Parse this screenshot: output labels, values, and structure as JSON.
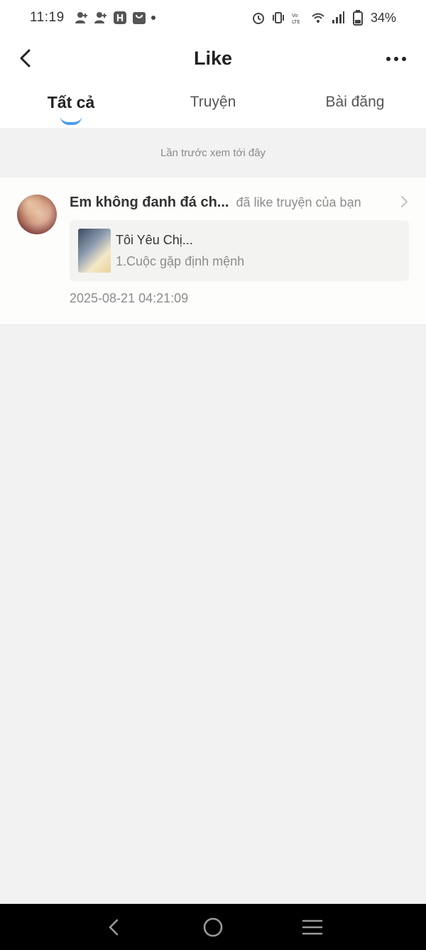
{
  "status_bar": {
    "time": "11:19",
    "battery": "34%",
    "left_icons": [
      "person-add-icon",
      "person-add-icon",
      "h-app-icon",
      "shopping-bag-icon",
      "notification-dot"
    ],
    "right_icons": [
      "alarm-icon",
      "vibrate-icon",
      "volte-icon",
      "wifi-icon",
      "signal-icon",
      "battery-icon"
    ]
  },
  "header": {
    "title": "Like",
    "back_icon": "chevron-left-icon",
    "more_icon": "more-horizontal-icon"
  },
  "tabs": [
    {
      "label": "Tất cả",
      "active": true
    },
    {
      "label": "Truyện",
      "active": false
    },
    {
      "label": "Bài đăng",
      "active": false
    }
  ],
  "last_seen_note": "Lần trước xem tới đây",
  "notifications": [
    {
      "user_name": "Em không đanh đá ch...",
      "action": "đã like truyện của bạn",
      "story_title": "Tôi Yêu Chị...",
      "chapter": "1.Cuộc gặp định mệnh",
      "timestamp": "2025-08-21 04:21:09"
    }
  ],
  "colors": {
    "accent": "#4a9bf0",
    "background": "#f2f2f2",
    "card": "#fdfdfc"
  }
}
